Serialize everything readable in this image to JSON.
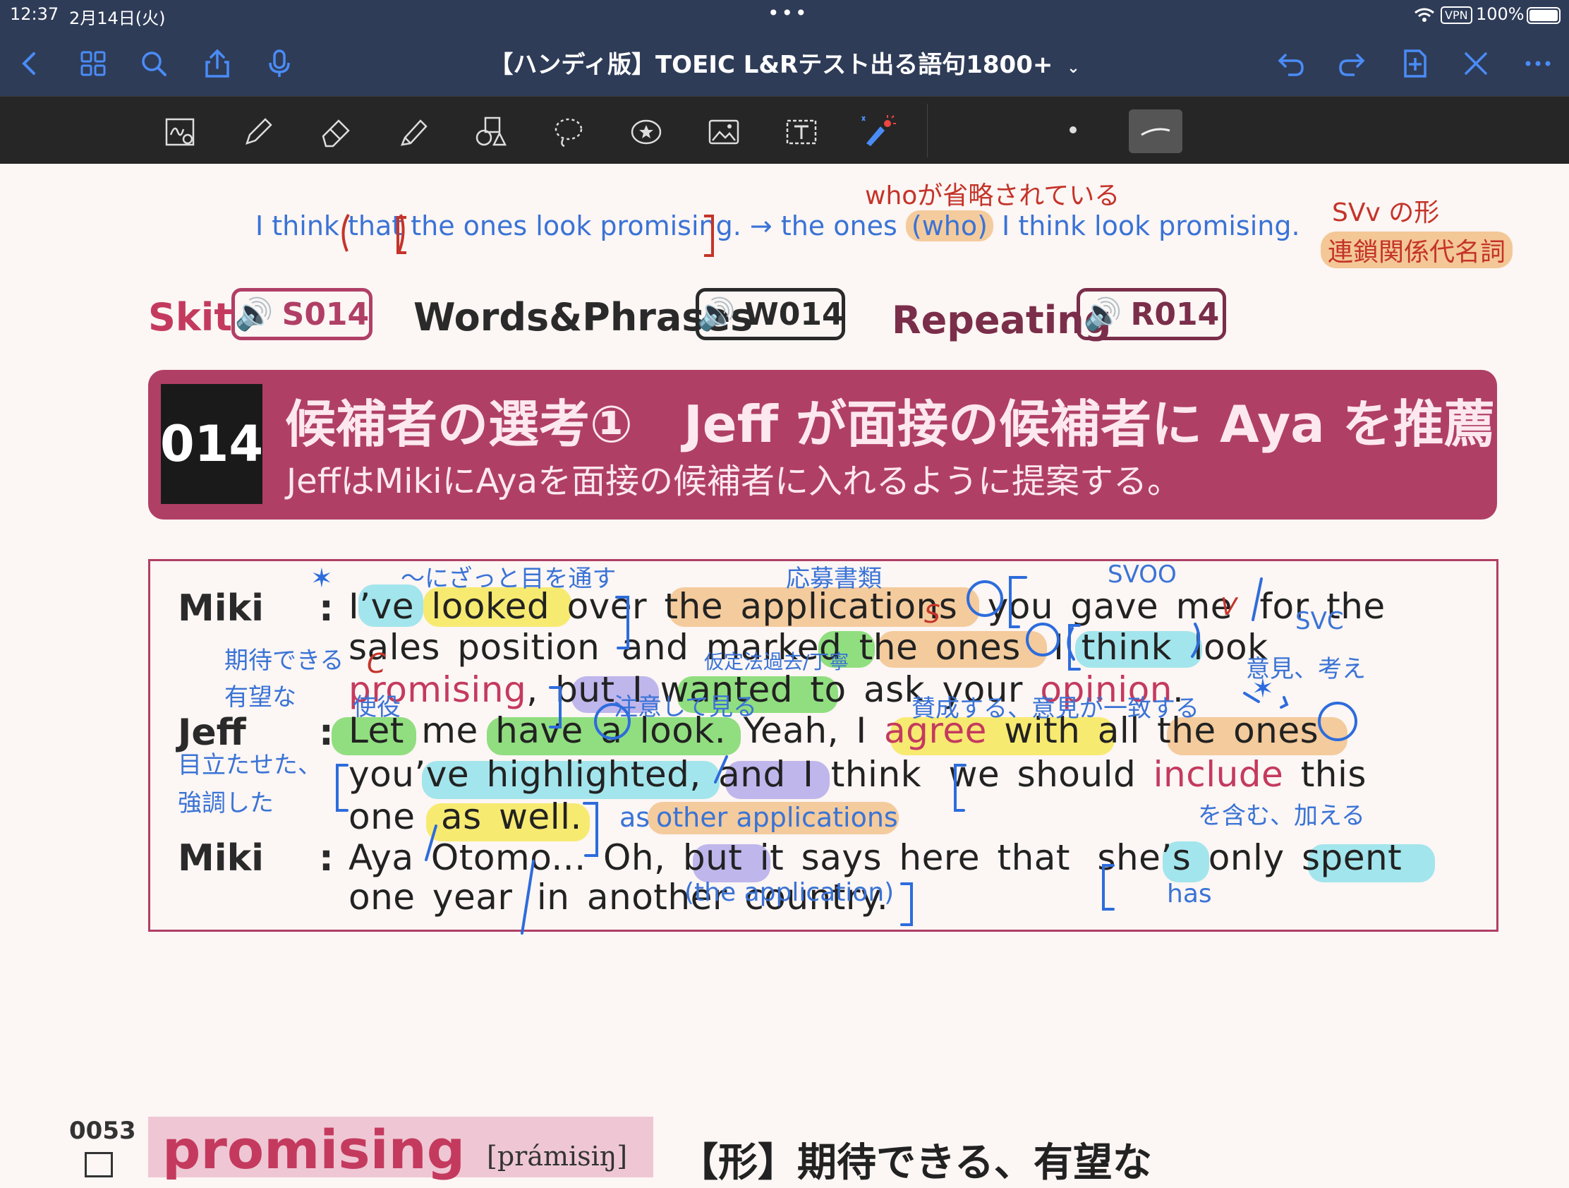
{
  "status": {
    "time": "12:37",
    "date": "2月14日(火)",
    "vpn": "VPN",
    "battery": "100%"
  },
  "nav": {
    "title": "【ハンディ版】TOEIC L&Rテスト出る語句1800+"
  },
  "top_notes": {
    "who_omitted": "whoが省略されている",
    "sentence_left": "I think that the ones look promising.",
    "arrow": "→",
    "sentence_right_a": "the ones",
    "who": "(who)",
    "sentence_right_b": "I think look promising.",
    "svv": "SVv の形",
    "chain": "連鎖関係代名詞"
  },
  "audio": {
    "skit_label": "Skit",
    "skit_code": "S014",
    "words_label": "Words&Phrases",
    "words_code": "W014",
    "repeat_label": "Repeating",
    "repeat_code": "R014"
  },
  "banner": {
    "number": "014",
    "title": "候補者の選考①　Jeff が面接の候補者に Aya を推薦",
    "subtitle": "JeffはMikiにAyaを面接の候補者に入れるように提案する。"
  },
  "dialogue": {
    "speaker1": "Miki",
    "speaker2": "Jeff",
    "speaker3": "Miki",
    "colon": ":",
    "l1": {
      "a": "I’ve",
      "b": "looked",
      "c": "over",
      "d": "the applications",
      "e": "you gave me",
      "f": "for the"
    },
    "l2": {
      "a": "sales position",
      "b": "and mark",
      "c": "ed",
      "d": "the ones",
      "e": "I think",
      "f": "look"
    },
    "l3": {
      "a": "promising",
      "b": ", ",
      "c": "but",
      "d": "I",
      "e": "wanted",
      "f": "to ask your",
      "g": "opinion",
      "h": "."
    },
    "l4": {
      "a": "Let",
      "b": "me",
      "c": "have",
      "d": "a",
      "e": "look.",
      "f": "Yeah, I",
      "g": "agree",
      "h": "with",
      "i": "all",
      "j": "the ones"
    },
    "l5": {
      "a": "you’ve highlighted,",
      "b": "and",
      "c": "I think",
      "d": "we should",
      "e": "include",
      "f": "this"
    },
    "l6": {
      "a": "one",
      "b": "as well."
    },
    "l7": {
      "a": "Aya Otomo... Oh,",
      "b": "but",
      "c": "it says here that",
      "d": "she’s",
      "e": "only",
      "f": "spent"
    },
    "l8": {
      "a": "one year",
      "b": "in another country."
    }
  },
  "notes": {
    "zatto": "～にざっと目を通す",
    "oubo": "応募書類",
    "svoo": "SVOO",
    "svc": "SVC",
    "s_mark": "S",
    "v_mark": "V",
    "c_mark": "C",
    "kitai1": "期待できる",
    "kitai2": "有望な",
    "katei": "仮定法過去/丁寧",
    "iken": "意見、考え",
    "shieki": "使役",
    "chui": "注意して見る",
    "sansei": "賛成する、意見が一致する",
    "medatase1": "目立たせた、",
    "medatase2": "強調した",
    "fukumu": "を含む、加える",
    "as_other_a": "as",
    "as_other_b": "other applications",
    "the_app": "(the application)",
    "has": "has"
  },
  "vocab": {
    "number": "0053",
    "word": "promising",
    "pron": "[prámisiŋ]",
    "meaning": "【形】期待できる、有望な"
  },
  "colors": {
    "nav_bg": "#2f3c58",
    "toolbar_bg": "#262626",
    "accent": "#4a8cf7",
    "banner": "#b03f66"
  }
}
